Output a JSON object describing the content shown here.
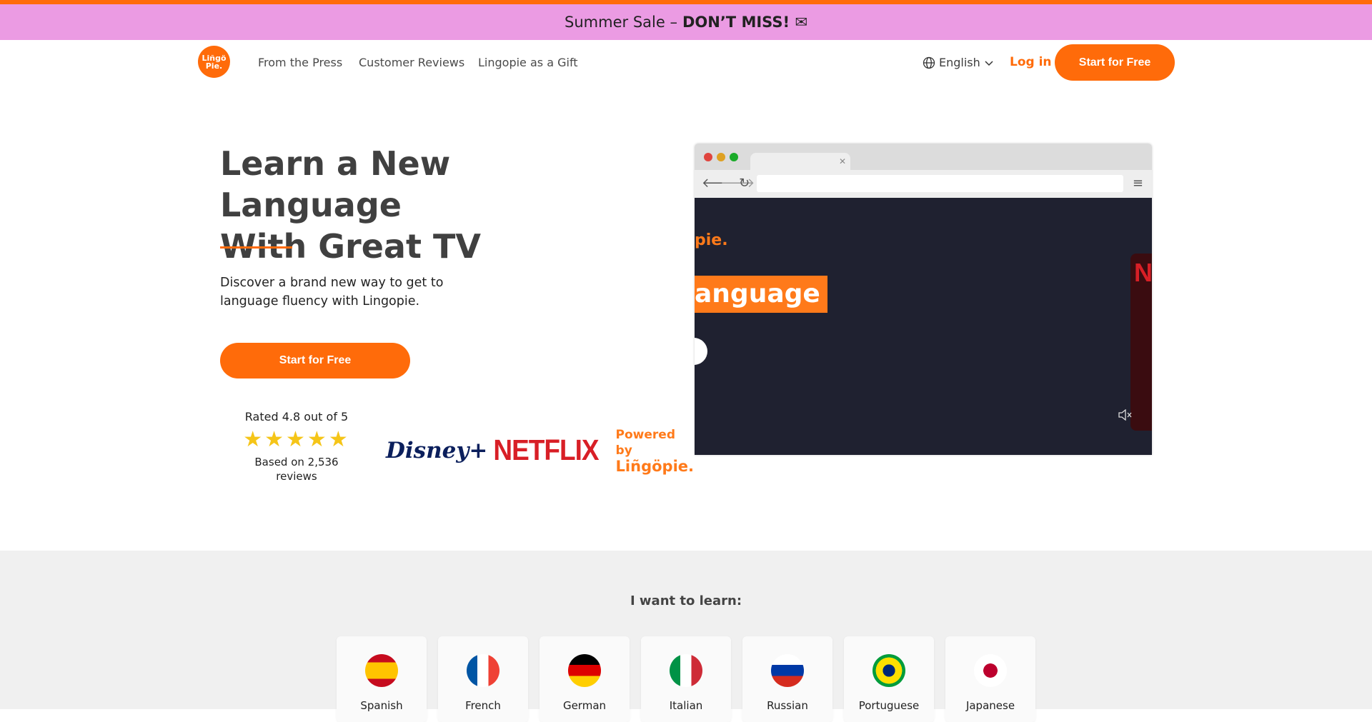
{
  "promo": {
    "text": "Summer Sale –",
    "bold": "DON’T MISS! ✉"
  },
  "logo": {
    "line1": "Liñgö",
    "line2": "Pie."
  },
  "nav": {
    "links": [
      "From the Press",
      "Customer Reviews",
      "Lingopie as a Gift"
    ],
    "language": "English",
    "login": "Log in",
    "cta": "Start for Free"
  },
  "hero": {
    "title_line1": "Learn a New Language",
    "title_line2": "With Great TV",
    "subtitle": "Discover a brand new way to get to language fluency with Lingopie.",
    "cta": "Start for Free"
  },
  "rating": {
    "text": "Rated 4.8 out of 5",
    "stars": "★★★★★",
    "based_on": "Based on 2,536 reviews"
  },
  "partners": {
    "disney": "Disney+",
    "netflix": "NETFLIX",
    "powered_by": "Powered by",
    "brand": "Liñgöpie."
  },
  "video": {
    "brand_fragment": "pie.",
    "label_fragment": "anguage",
    "card_fragment": "N"
  },
  "learn": {
    "title": "I want to learn:",
    "languages": [
      "Spanish",
      "French",
      "German",
      "Italian",
      "Russian",
      "Portuguese",
      "Japanese"
    ]
  },
  "colors": {
    "accent": "#ff6b0a",
    "promo_bg": "#eb9be3",
    "section_bg": "#f0f0f0"
  },
  "icons": [
    "globe-icon",
    "chevron-down-icon",
    "back-arrow-icon",
    "forward-arrow-icon",
    "reload-icon",
    "menu-icon",
    "mute-icon"
  ]
}
